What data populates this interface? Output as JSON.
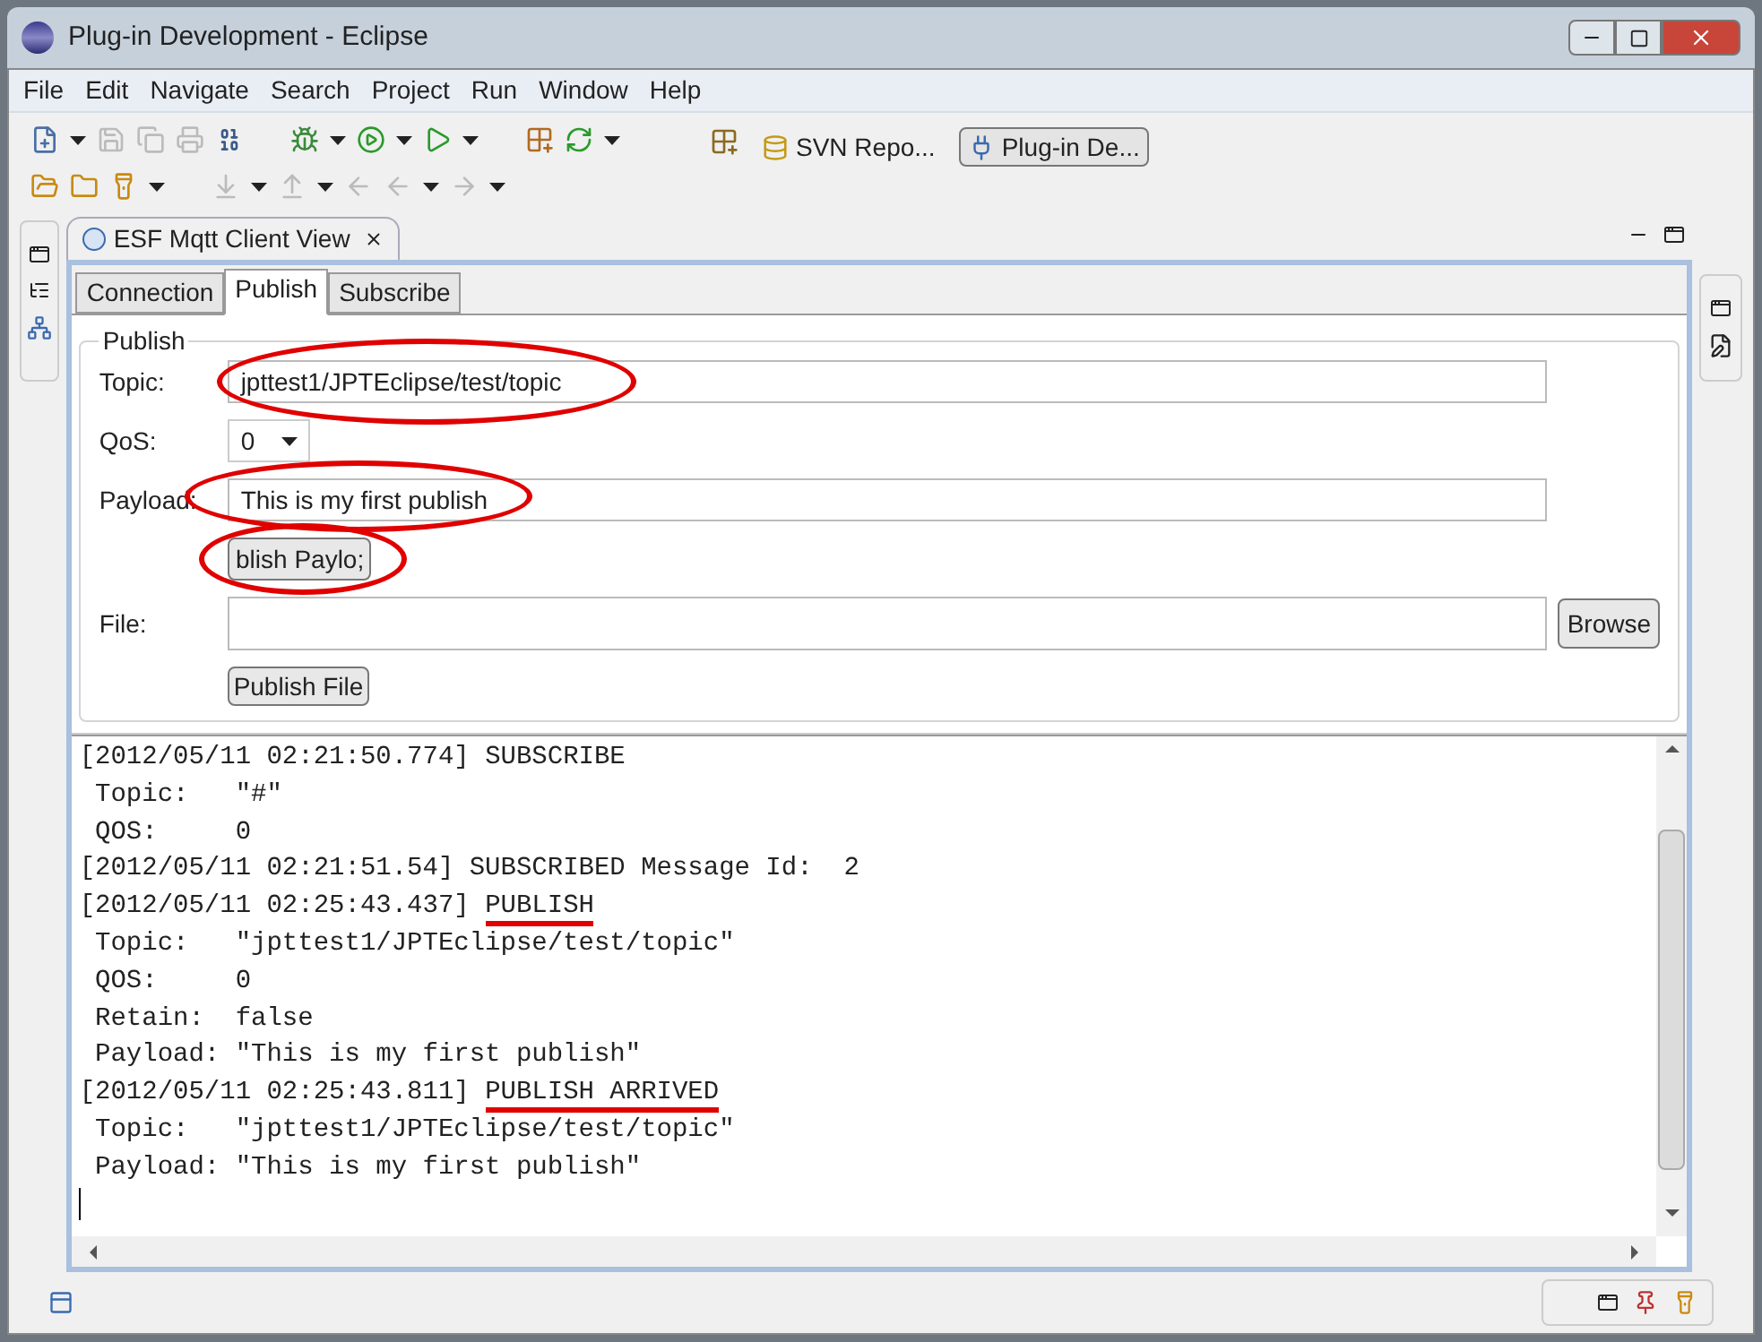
{
  "window": {
    "title": "Plug-in Development - Eclipse"
  },
  "menu": [
    "File",
    "Edit",
    "Navigate",
    "Search",
    "Project",
    "Run",
    "Window",
    "Help"
  ],
  "perspectives": [
    {
      "label": "SVN Repo...",
      "selected": false
    },
    {
      "label": "Plug-in De...",
      "selected": true
    }
  ],
  "view": {
    "title": "ESF Mqtt Client View"
  },
  "tabs": [
    {
      "label": "Connection",
      "selected": false
    },
    {
      "label": "Publish",
      "selected": true
    },
    {
      "label": "Subscribe",
      "selected": false
    }
  ],
  "publish": {
    "group_title": "Publish",
    "topic_label": "Topic:",
    "topic_value": "jpttest1/JPTEclipse/test/topic",
    "topic_circled": true,
    "qos_label": "QoS:",
    "qos_value": "0",
    "payload_label": "Payload:",
    "payload_value": "This is my first publish",
    "payload_circled": true,
    "publish_payload_button": "blish Paylo;",
    "button_circled": true,
    "file_label": "File:",
    "browse_button": "Browse",
    "publish_file_button": "Publish File"
  },
  "log": [
    {
      "kind": "event",
      "prefix": "[2012/05/11 02:21:50.774] ",
      "event": "SUBSCRIBE",
      "underlined": false
    },
    {
      "kind": "detail",
      "text": " Topic:   \"#\""
    },
    {
      "kind": "detail",
      "text": " QOS:     0"
    },
    {
      "kind": "event",
      "prefix": "[2012/05/11 02:21:51.54] ",
      "event": "SUBSCRIBED Message Id:  2",
      "underlined": false
    },
    {
      "kind": "event",
      "prefix": "[2012/05/11 02:25:43.437] ",
      "event": "PUBLISH",
      "underlined": true
    },
    {
      "kind": "detail",
      "text": " Topic:   \"jpttest1/JPTEclipse/test/topic\""
    },
    {
      "kind": "detail",
      "text": " QOS:     0"
    },
    {
      "kind": "detail",
      "text": " Retain:  false"
    },
    {
      "kind": "detail",
      "text": " Payload: \"This is my first publish\""
    },
    {
      "kind": "event",
      "prefix": "[2012/05/11 02:25:43.811] ",
      "event": "PUBLISH ARRIVED",
      "underlined": true
    },
    {
      "kind": "detail",
      "text": " Topic:   \"jpttest1/JPTEclipse/test/topic\""
    },
    {
      "kind": "detail",
      "text": " Payload: \"This is my first publish\""
    }
  ]
}
